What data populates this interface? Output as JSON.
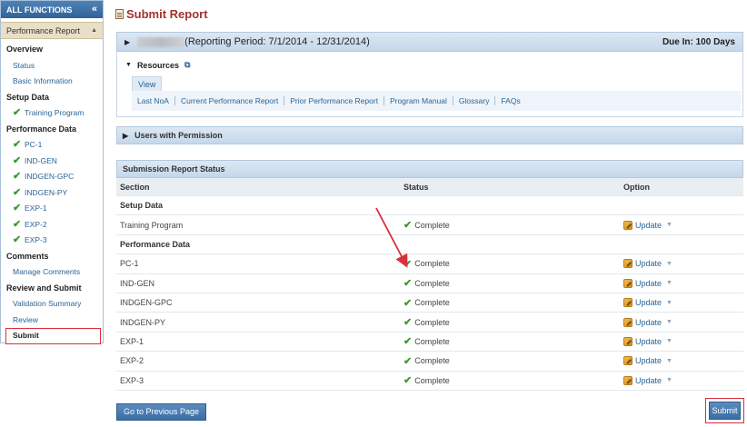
{
  "sidebar": {
    "header": "ALL FUNCTIONS",
    "collapse_glyph": "«",
    "section_title": "Performance Report",
    "sections": [
      {
        "title": "Overview",
        "items": [
          {
            "label": "Status",
            "checked": false
          },
          {
            "label": "Basic Information",
            "checked": false
          }
        ]
      },
      {
        "title": "Setup Data",
        "items": [
          {
            "label": "Training Program",
            "checked": true
          }
        ]
      },
      {
        "title": "Performance Data",
        "items": [
          {
            "label": "PC-1",
            "checked": true
          },
          {
            "label": "IND-GEN",
            "checked": true
          },
          {
            "label": "INDGEN-GPC",
            "checked": true
          },
          {
            "label": "INDGEN-PY",
            "checked": true
          },
          {
            "label": "EXP-1",
            "checked": true
          },
          {
            "label": "EXP-2",
            "checked": true
          },
          {
            "label": "EXP-3",
            "checked": true
          }
        ]
      },
      {
        "title": "Comments",
        "items": [
          {
            "label": "Manage Comments",
            "checked": false
          }
        ]
      },
      {
        "title": "Review and Submit",
        "items": [
          {
            "label": "Validation Summary",
            "checked": false
          },
          {
            "label": "Review",
            "checked": false
          },
          {
            "label": "Submit",
            "checked": false,
            "active": true
          }
        ]
      }
    ]
  },
  "page": {
    "title": "Submit Report",
    "reporting_period": "(Reporting Period: 7/1/2014 - 12/31/2014)",
    "due": "Due In: 100 Days"
  },
  "resources": {
    "title": "Resources",
    "tab": "View",
    "links": [
      "Last NoA",
      "Current Performance Report",
      "Prior Performance Report",
      "Program Manual",
      "Glossary",
      "FAQs"
    ]
  },
  "permissions": {
    "title": "Users with Permission"
  },
  "submission": {
    "title": "Submission Report Status",
    "columns": [
      "Section",
      "Status",
      "Option"
    ],
    "groups": [
      {
        "name": "Setup Data",
        "rows": [
          {
            "section": "Training Program",
            "status": "Complete",
            "option": "Update"
          }
        ]
      },
      {
        "name": "Performance Data",
        "rows": [
          {
            "section": "PC-1",
            "status": "Complete",
            "option": "Update"
          },
          {
            "section": "IND-GEN",
            "status": "Complete",
            "option": "Update"
          },
          {
            "section": "INDGEN-GPC",
            "status": "Complete",
            "option": "Update"
          },
          {
            "section": "INDGEN-PY",
            "status": "Complete",
            "option": "Update"
          },
          {
            "section": "EXP-1",
            "status": "Complete",
            "option": "Update"
          },
          {
            "section": "EXP-2",
            "status": "Complete",
            "option": "Update"
          },
          {
            "section": "EXP-3",
            "status": "Complete",
            "option": "Update"
          }
        ]
      }
    ]
  },
  "buttons": {
    "previous": "Go to Previous Page",
    "submit": "Submit"
  },
  "colors": {
    "accent": "#3b6ea3",
    "title": "#a0332e",
    "check": "#3a9a2f",
    "highlight": "#d9303a"
  }
}
